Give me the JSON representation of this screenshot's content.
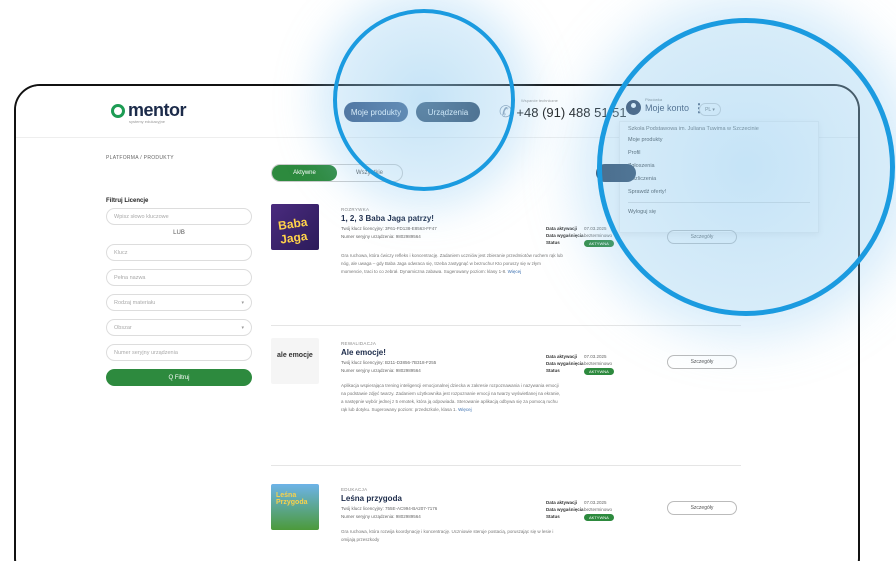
{
  "header": {
    "logo_text": "mentor",
    "logo_sub": "systemy edukacyjne",
    "products_label": "Moje produkty",
    "devices_label": "Urządzenia",
    "phone_label": "Wsparcie techniczne",
    "phone_number": "+48 (91) 488 51 51",
    "account_small": "Placówka",
    "account_label": "Moje konto",
    "language": "PL ▾"
  },
  "dropdown": {
    "school": "Szkoła Podstawowa im. Juliana Tuwima w Szczecinie",
    "items": [
      "Moje produkty",
      "Profil",
      "Zgłoszenia",
      "Rozliczenia",
      "Sprawdź oferty!"
    ],
    "logout": "Wyloguj się"
  },
  "breadcrumb": "PLATFORMA / PRODUKTY",
  "filters": {
    "title": "Filtruj Licencje",
    "keywords_placeholder": "Wpisz słowo kluczowe",
    "or_label": "LUB",
    "key_placeholder": "Klucz",
    "name_placeholder": "Pełna nazwa",
    "material_placeholder": "Rodzaj materiału",
    "area_placeholder": "Obszar",
    "serial_placeholder": "Numer seryjny urządzenia",
    "filter_button": "Q Filtruj"
  },
  "tabs": {
    "active": "Aktywne",
    "inactive": "Wszystkie"
  },
  "products": [
    {
      "category": "ROZRYWKA",
      "title": "1, 2, 3 Baba Jaga patrzy!",
      "license": "Twój klucz licencyjny: 3F61-FD138-E8563-FF47",
      "serial": "Numer seryjny urządzenia: 9802989564",
      "description": "Gra ruchowa, która ćwiczy refleks i koncentrację. Zadaniem uczniów jest zbieranie przedmiotów ruchem rąk lub nóg, ale uwaga – gdy Baba Jaga odwraca się, trzeba zastygnąć w bezruchu! Kto poruszy się w złym momencie, traci to co zebrał. Dynamiczna zabawa. Sugerowany poziom: klasy 1-8.",
      "more": "Więcej",
      "activation_date": "07.03.2025",
      "expiry_date": "bezterminowo",
      "status": "AKTYWNA",
      "details": "Szczegóły",
      "image_text": "Baba Jaga"
    },
    {
      "category": "REWALIDACJA",
      "title": "Ale emocje!",
      "license": "Twój klucz licencyjny: B211-D3856-7B318-F255",
      "serial": "Numer seryjny urządzenia: 9802989564",
      "description": "Aplikacja wspierająca trening inteligencji emocjonalnej dziecka w zakresie rozpoznawania i nazywania emocji na podstawie zdjęć twarzy. Zadaniem użytkownika jest rozpoznanie emocji na twarzy wyświetlanej na ekranie, a następnie wybór jednej z 5 emotek, która ją odpowiada. Sterowanie aplikacją odbywa się za pomocą ruchu rąk lub dotyku. Sugerowany poziom: przedszkole, klasa 1.",
      "more": "Więcej",
      "activation_date": "07.03.2025",
      "expiry_date": "bezterminowo",
      "status": "AKTYWNA",
      "details": "Szczegóły",
      "image_text": "ale emocje"
    },
    {
      "category": "EDUKACJA",
      "title": "Leśna przygoda",
      "license": "Twój klucz licencyjny: 755E-AC994-BA207-7176",
      "serial": "Numer seryjny urządzenia: 9802989564",
      "description": "Gra ruchowa, która rozwija koordynację i koncentrację. Uczniowie steruje postacią, poruszając się w lesie i omijają przeszkody",
      "more": "",
      "activation_date": "07.03.2025",
      "expiry_date": "bezterminowo",
      "status": "AKTYWNA",
      "details": "Szczegóły",
      "image_text": "Leśna Przygoda"
    }
  ],
  "info_labels": {
    "activation": "Data aktywacji",
    "expiry": "Data wygaśnięcia",
    "status": "Status"
  },
  "colors": {
    "navy": "#1c2b4a",
    "green": "#2d8a3e",
    "highlight_ring": "#1b9be0"
  }
}
